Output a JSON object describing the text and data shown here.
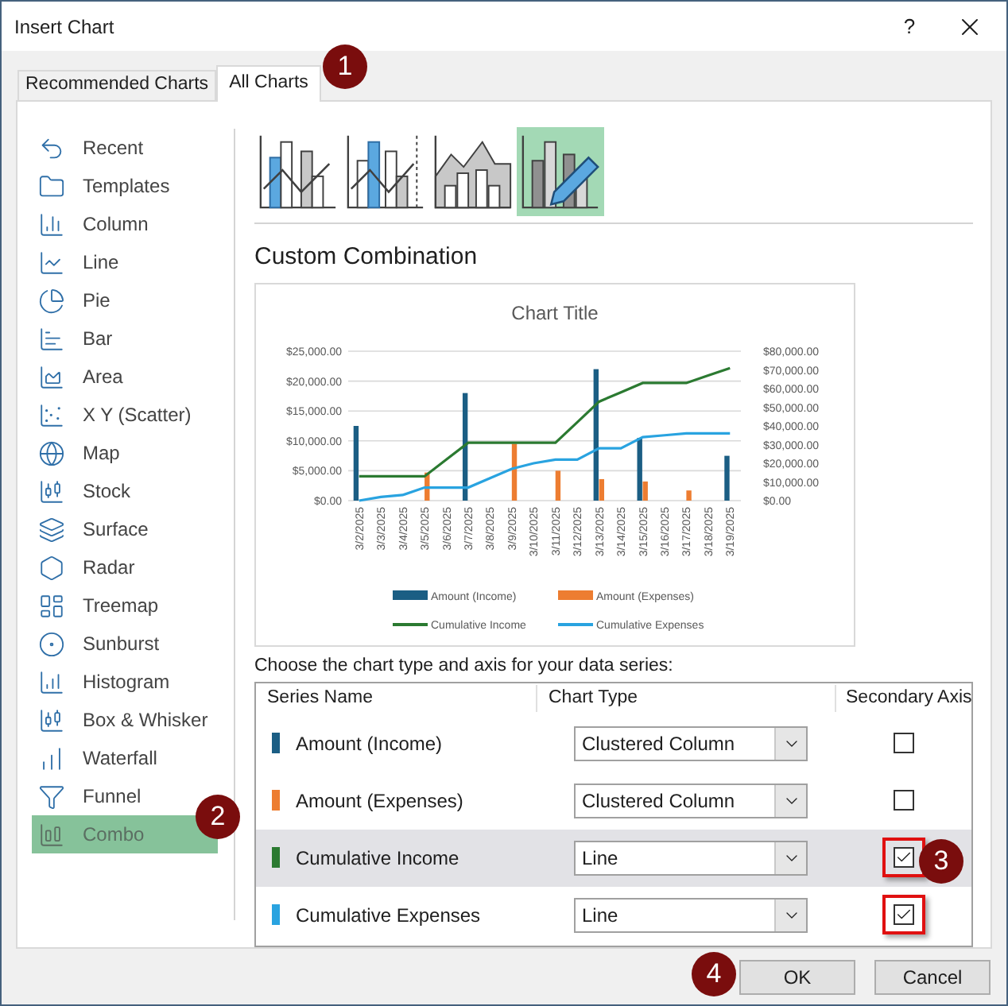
{
  "window": {
    "title": "Insert Chart",
    "help": "?"
  },
  "tabs": [
    {
      "label": "Recommended Charts",
      "selected": false
    },
    {
      "label": "All Charts",
      "selected": true
    }
  ],
  "sidebar": {
    "items": [
      {
        "label": "Recent",
        "selected": false
      },
      {
        "label": "Templates",
        "selected": false
      },
      {
        "label": "Column",
        "selected": false
      },
      {
        "label": "Line",
        "selected": false
      },
      {
        "label": "Pie",
        "selected": false
      },
      {
        "label": "Bar",
        "selected": false
      },
      {
        "label": "Area",
        "selected": false
      },
      {
        "label": "X Y (Scatter)",
        "selected": false
      },
      {
        "label": "Map",
        "selected": false
      },
      {
        "label": "Stock",
        "selected": false
      },
      {
        "label": "Surface",
        "selected": false
      },
      {
        "label": "Radar",
        "selected": false
      },
      {
        "label": "Treemap",
        "selected": false
      },
      {
        "label": "Sunburst",
        "selected": false
      },
      {
        "label": "Histogram",
        "selected": false
      },
      {
        "label": "Box & Whisker",
        "selected": false
      },
      {
        "label": "Waterfall",
        "selected": false
      },
      {
        "label": "Funnel",
        "selected": false
      },
      {
        "label": "Combo",
        "selected": true
      }
    ]
  },
  "chart_subtypes": [
    {
      "selected": false
    },
    {
      "selected": false
    },
    {
      "selected": false
    },
    {
      "selected": true
    }
  ],
  "subtype_title": "Custom Combination",
  "preview": {
    "chart_data": {
      "type": "bar",
      "title": "Chart Title",
      "categories": [
        "3/2/2025",
        "3/3/2025",
        "3/4/2025",
        "3/5/2025",
        "3/6/2025",
        "3/7/2025",
        "3/8/2025",
        "3/9/2025",
        "3/10/2025",
        "3/11/2025",
        "3/12/2025",
        "3/13/2025",
        "3/14/2025",
        "3/15/2025",
        "3/16/2025",
        "3/17/2025",
        "3/18/2025",
        "3/19/2025"
      ],
      "series": [
        {
          "name": "Amount (Income)",
          "color": "#1b5e84",
          "type": "bar",
          "values": [
            12500,
            null,
            null,
            null,
            null,
            18000,
            null,
            null,
            null,
            null,
            null,
            22000,
            null,
            10500,
            null,
            null,
            null,
            7500
          ]
        },
        {
          "name": "Amount (Expenses)",
          "color": "#ed7d31",
          "type": "bar",
          "values": [
            null,
            null,
            null,
            4700,
            null,
            null,
            null,
            9500,
            null,
            5000,
            null,
            3600,
            null,
            3200,
            null,
            1700,
            null,
            null
          ]
        },
        {
          "name": "Cumulative Income",
          "color": "#2b7a31",
          "type": "line",
          "axis": "y2",
          "values": [
            13000,
            13000,
            13000,
            13000,
            22000,
            31000,
            31000,
            31000,
            31000,
            31000,
            42000,
            53000,
            58000,
            63000,
            63000,
            63000,
            67000,
            71000
          ]
        },
        {
          "name": "Cumulative Expenses",
          "color": "#29a3e0",
          "type": "line",
          "axis": "y2",
          "values": [
            0,
            2000,
            3000,
            7000,
            7000,
            7000,
            12000,
            17000,
            20000,
            22000,
            22000,
            28000,
            28000,
            34000,
            35000,
            36000,
            36000,
            36000
          ]
        }
      ],
      "grid": true,
      "legend": true,
      "ylim": [
        0,
        25000
      ],
      "yticks": [
        {
          "value": 0,
          "label": "$0.00"
        },
        {
          "value": 5000,
          "label": "$5,000.00"
        },
        {
          "value": 10000,
          "label": "$10,000.00"
        },
        {
          "value": 15000,
          "label": "$15,000.00"
        },
        {
          "value": 20000,
          "label": "$20,000.00"
        },
        {
          "value": 25000,
          "label": "$25,000.00"
        }
      ],
      "y2lim": [
        0,
        80000
      ],
      "y2ticks": [
        {
          "value": 0,
          "label": "$0.00"
        },
        {
          "value": 10000,
          "label": "$10,000.00"
        },
        {
          "value": 20000,
          "label": "$20,000.00"
        },
        {
          "value": 30000,
          "label": "$30,000.00"
        },
        {
          "value": 40000,
          "label": "$40,000.00"
        },
        {
          "value": 50000,
          "label": "$50,000.00"
        },
        {
          "value": 60000,
          "label": "$60,000.00"
        },
        {
          "value": 70000,
          "label": "$70,000.00"
        },
        {
          "value": 80000,
          "label": "$80,000.00"
        }
      ]
    }
  },
  "series_table": {
    "instruction": "Choose the chart type and axis for your data series:",
    "columns": [
      "Series Name",
      "Chart Type",
      "Secondary Axis"
    ],
    "rows": [
      {
        "name": "Amount (Income)",
        "color": "#1b5e84",
        "chart_type": "Clustered Column",
        "secondary_axis": false,
        "selected": false,
        "highlighted": false
      },
      {
        "name": "Amount (Expenses)",
        "color": "#ed7d31",
        "chart_type": "Clustered Column",
        "secondary_axis": false,
        "selected": false,
        "highlighted": false
      },
      {
        "name": "Cumulative Income",
        "color": "#2b7a31",
        "chart_type": "Line",
        "secondary_axis": true,
        "selected": true,
        "highlighted": true
      },
      {
        "name": "Cumulative Expenses",
        "color": "#29a3e0",
        "chart_type": "Line",
        "secondary_axis": true,
        "selected": false,
        "highlighted": true
      }
    ]
  },
  "buttons": [
    {
      "label": "OK"
    },
    {
      "label": "Cancel"
    }
  ],
  "callouts": [
    {
      "label": "1"
    },
    {
      "label": "2"
    },
    {
      "label": "3"
    },
    {
      "label": "4"
    }
  ]
}
